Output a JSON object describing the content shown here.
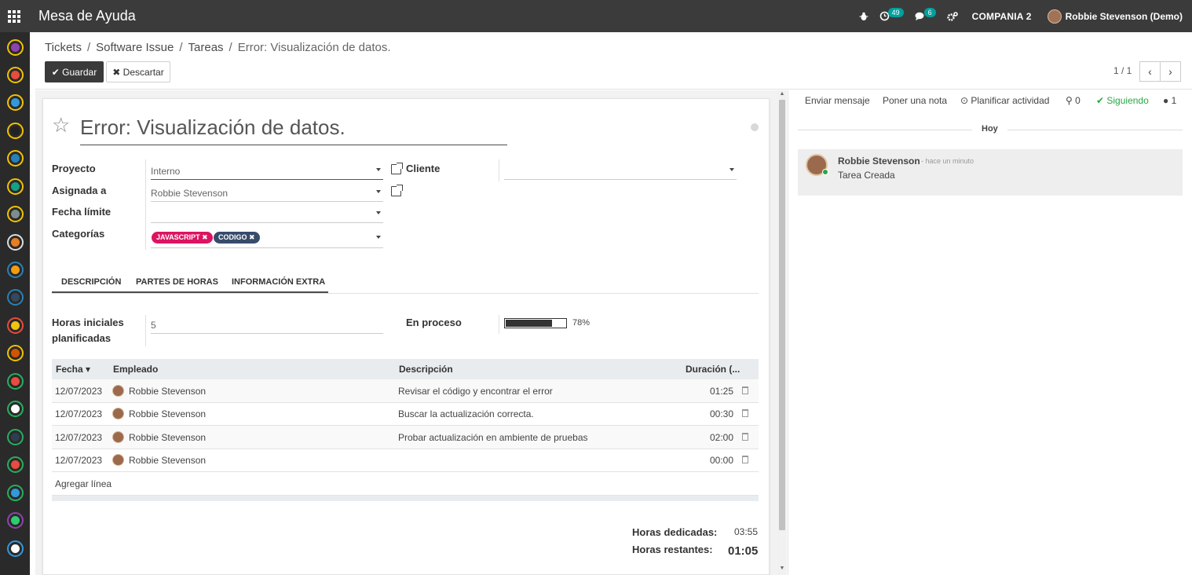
{
  "app": {
    "title": "Mesa de Ayuda"
  },
  "topbar": {
    "activity_count": "49",
    "message_count": "6",
    "company": "COMPANIA 2",
    "user": "Robbie Stevenson (Demo)"
  },
  "breadcrumb": {
    "items": [
      "Tickets",
      "Software Issue",
      "Tareas"
    ],
    "current": "Error: Visualización de datos."
  },
  "buttons": {
    "save": "✔ Guardar",
    "discard": "✖ Descartar"
  },
  "pager": {
    "value": "1 / 1",
    "prev": "‹",
    "next": "›"
  },
  "form": {
    "title": "Error: Visualización de datos.",
    "labels": {
      "project": "Proyecto",
      "assigned": "Asignada a",
      "deadline": "Fecha límite",
      "categories": "Categorías",
      "client": "Cliente",
      "planned_hours_1": "Horas iniciales",
      "planned_hours_2": "planificadas",
      "progress": "En proceso"
    },
    "values": {
      "project": "Interno",
      "assigned": "Robbie Stevenson",
      "deadline": "",
      "client": "",
      "planned_hours": "5",
      "progress_text": "78%"
    },
    "progress": 0.78,
    "tags": [
      {
        "label": "JAVASCRIPT ✖",
        "color": "#dc1461"
      },
      {
        "label": "CODIGO ✖",
        "color": "#374b6b"
      }
    ],
    "tabs": [
      "DESCRIPCIÓN",
      "PARTES DE HORAS",
      "INFORMACIÓN EXTRA"
    ]
  },
  "timesheet": {
    "headers": {
      "date": "Fecha ▾",
      "employee": "Empleado",
      "description": "Descripción",
      "duration": "Duración (..."
    },
    "rows": [
      {
        "date": "12/07/2023",
        "employee": "Robbie Stevenson",
        "description": "Revisar el código y encontrar el error",
        "duration": "01:25"
      },
      {
        "date": "12/07/2023",
        "employee": "Robbie Stevenson",
        "description": "Buscar la actualización correcta.",
        "duration": "00:30"
      },
      {
        "date": "12/07/2023",
        "employee": "Robbie Stevenson",
        "description": "Probar actualización en ambiente de pruebas",
        "duration": "02:00"
      },
      {
        "date": "12/07/2023",
        "employee": "Robbie Stevenson",
        "description": "",
        "duration": "00:00"
      }
    ],
    "add_line": "Agregar línea"
  },
  "totals": {
    "spent_label": "Horas dedicadas:",
    "spent_value": "03:55",
    "remaining_label": "Horas restantes:",
    "remaining_value": "01:05"
  },
  "chatter": {
    "send_message": "Enviar mensaje",
    "log_note": "Poner una nota",
    "schedule": "⊙ Planificar actividad",
    "attachments": "0",
    "following": "✔ Siguiendo",
    "followers": "1",
    "today": "Hoy",
    "message": {
      "author": "Robbie Stevenson",
      "time": "- hace un minuto",
      "body": "Tarea Creada"
    }
  },
  "colors": {
    "topbar": "#3b3b3b",
    "sidebar": "#2a2a2a",
    "accent": "#00a09d",
    "following": "#28a745"
  }
}
